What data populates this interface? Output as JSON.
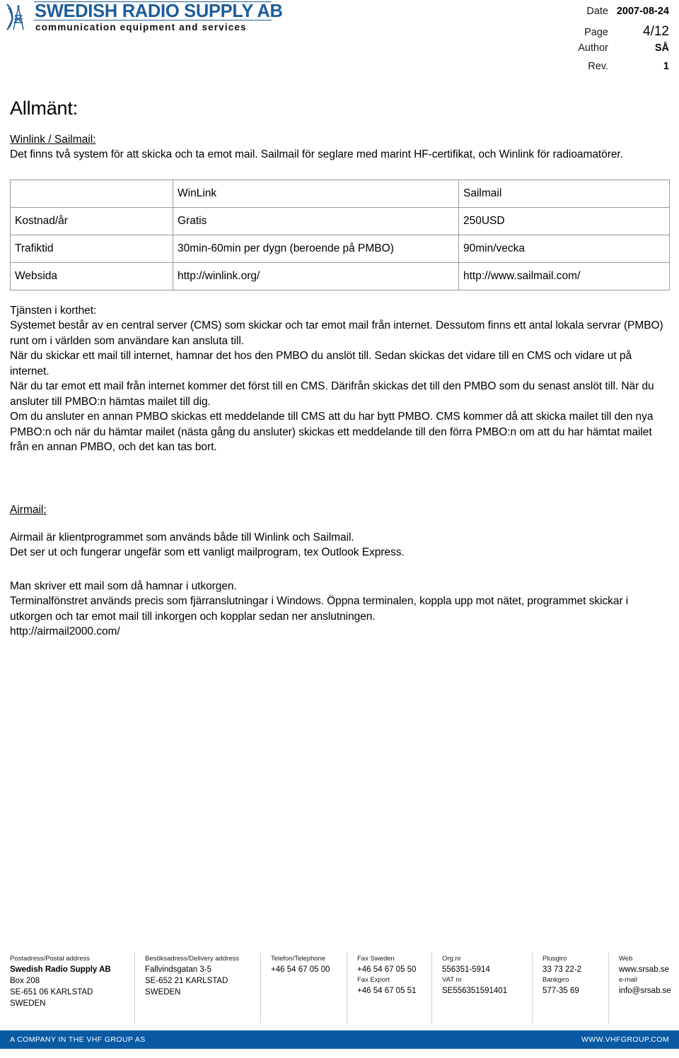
{
  "header": {
    "logo": {
      "icon": "radio-tower-icon",
      "title": "SWEDISH RADIO SUPPLY AB",
      "tagline": "communication equipment and services",
      "brand_color": "#1d5d9b"
    },
    "meta": [
      {
        "label": "Date",
        "value": "2007-08-24"
      },
      {
        "label": "Page",
        "value": "4/12"
      },
      {
        "label": "Author",
        "value": "SÅ"
      },
      {
        "label": "Rev.",
        "value": "1"
      }
    ]
  },
  "main": {
    "section_title": "Allmänt:",
    "subhead_winlink": "Winlink / Sailmail:",
    "intro": "Det finns två system för att skicka och ta emot mail. Sailmail för seglare med marint HF-certifikat, och Winlink för radioamatörer.",
    "table": {
      "headers": [
        "",
        "WinLink",
        "Sailmail"
      ],
      "rows": [
        [
          "Kostnad/år",
          "Gratis",
          "250USD"
        ],
        [
          "Trafiktid",
          "30min-60min per dygn (beroende på PMBO)",
          "90min/vecka"
        ],
        [
          "Websida",
          "http://winlink.org/",
          "http://www.sailmail.com/"
        ]
      ]
    },
    "service_label": "Tjänsten i korthet:",
    "service_paragraphs": [
      "Systemet består av en central server (CMS) som skickar och tar emot mail från internet. Dessutom finns ett antal lokala servrar (PMBO) runt om i världen som användare kan ansluta till.",
      "När du skickar ett mail till internet, hamnar det hos den PMBO du anslöt till. Sedan skickas det vidare till en CMS och vidare ut på internet.",
      "När du tar emot ett mail från internet kommer det först till en CMS. Därifrån skickas det till den PMBO som du senast anslöt till. När du ansluter till PMBO:n hämtas mailet till dig.",
      "Om du ansluter en annan PMBO skickas ett meddelande till CMS att du har bytt PMBO. CMS kommer då att skicka mailet till den nya PMBO:n och när du hämtar mailet (nästa gång du ansluter) skickas ett meddelande till den  förra PMBO:n om att du har hämtat mailet från en annan PMBO, och det kan tas bort."
    ],
    "subhead_airmail": "Airmail:",
    "airmail_paragraphs": [
      "Airmail är klientprogrammet som används både till Winlink och Sailmail.",
      "Det ser ut och fungerar ungefär som ett vanligt mailprogram, tex Outlook Express."
    ],
    "airmail_usage": [
      "Man skriver ett mail som då hamnar i utkorgen.",
      "Terminalfönstret används precis som fjärranslutningar i Windows. Öppna terminalen, koppla upp mot nätet, programmet skickar i utkorgen och tar emot mail till inkorgen och kopplar sedan ner anslutningen.",
      "http://airmail2000.com/"
    ]
  },
  "footer": {
    "columns": [
      {
        "head": "Postadress/Postal address",
        "lines": [
          "Swedish Radio Supply AB",
          "Box 208",
          "SE-651 06  KARLSTAD",
          "SWEDEN"
        ],
        "bold_first": true
      },
      {
        "head": "Besöksadress/Delivery address",
        "lines": [
          "Fallvindsgatan 3-5",
          "SE-652 21  KARLSTAD",
          "SWEDEN"
        ],
        "bold_first": false
      },
      {
        "head": "Telefon/Telephone",
        "lines": [
          "+46 54 67 05 00"
        ],
        "bold_first": false
      },
      {
        "head": "Fax Sweden",
        "lines": [
          "+46 54 67 05 50"
        ],
        "head2": "Fax Export",
        "lines2": [
          "+46 54 67 05 51"
        ],
        "bold_first": false
      },
      {
        "head": "Org.nr",
        "lines": [
          "556351-5914"
        ],
        "head2": "VAT nr",
        "lines2": [
          "SE556351591401"
        ],
        "bold_first": false
      },
      {
        "head": "Plusgiro",
        "lines": [
          "33 73 22-2"
        ],
        "head2": "Bankgiro",
        "lines2": [
          "577-35 69"
        ],
        "bold_first": false
      },
      {
        "head": "Web",
        "lines": [
          "www.srsab.se"
        ],
        "head2": "e-mail",
        "lines2": [
          "info@srsab.se"
        ],
        "bold_first": false
      }
    ],
    "bar": {
      "left": "A COMPANY IN THE VHF GROUP AS",
      "right": "WWW.VHFGROUP.COM",
      "color": "#0a5aa3"
    }
  }
}
